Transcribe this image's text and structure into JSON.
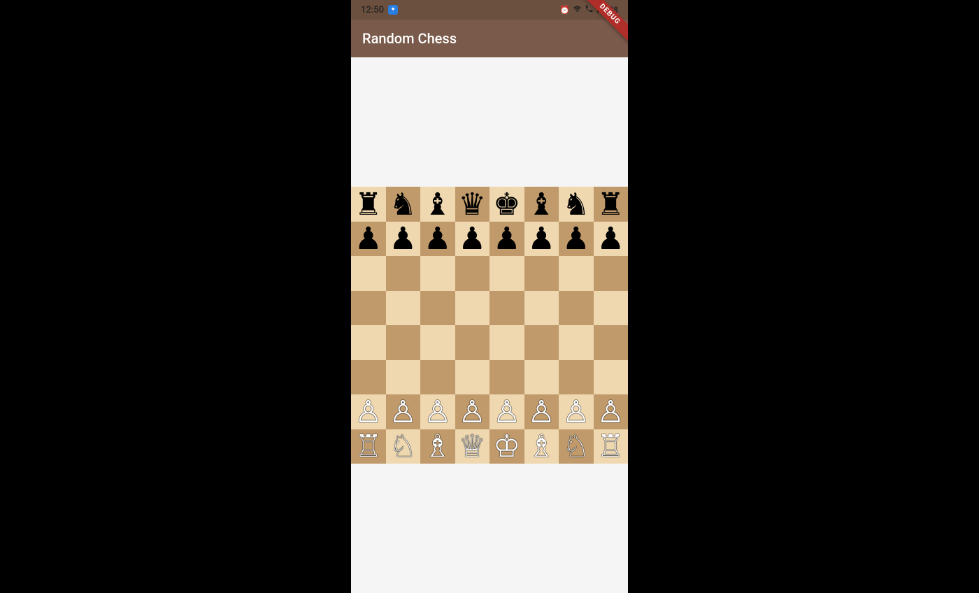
{
  "status": {
    "time": "12:50",
    "battery": "98",
    "icons": [
      "alarm",
      "wifi",
      "wifi-calling",
      "signal"
    ]
  },
  "app": {
    "title": "Random Chess",
    "debug_label": "DEBUG"
  },
  "colors": {
    "light_square": "#efd8b0",
    "dark_square": "#c09a6b",
    "app_bar": "#7a5a4a",
    "status_bar": "#6b4f3f"
  },
  "piece_glyphs": {
    "wK": "♔",
    "wQ": "♕",
    "wR": "♖",
    "wB": "♗",
    "wN": "♘",
    "wP": "♙",
    "bK": "♚",
    "bQ": "♛",
    "bR": "♜",
    "bB": "♝",
    "bN": "♞",
    "bP": "♟"
  },
  "board": [
    [
      "bR",
      "bN",
      "bB",
      "bQ",
      "bK",
      "bB",
      "bN",
      "bR"
    ],
    [
      "bP",
      "bP",
      "bP",
      "bP",
      "bP",
      "bP",
      "bP",
      "bP"
    ],
    [
      "",
      "",
      "",
      "",
      "",
      "",
      "",
      ""
    ],
    [
      "",
      "",
      "",
      "",
      "",
      "",
      "",
      ""
    ],
    [
      "",
      "",
      "",
      "",
      "",
      "",
      "",
      ""
    ],
    [
      "",
      "",
      "",
      "",
      "",
      "",
      "",
      ""
    ],
    [
      "wP",
      "wP",
      "wP",
      "wP",
      "wP",
      "wP",
      "wP",
      "wP"
    ],
    [
      "wR",
      "wN",
      "wB",
      "wQ",
      "wK",
      "wB",
      "wN",
      "wR"
    ]
  ]
}
